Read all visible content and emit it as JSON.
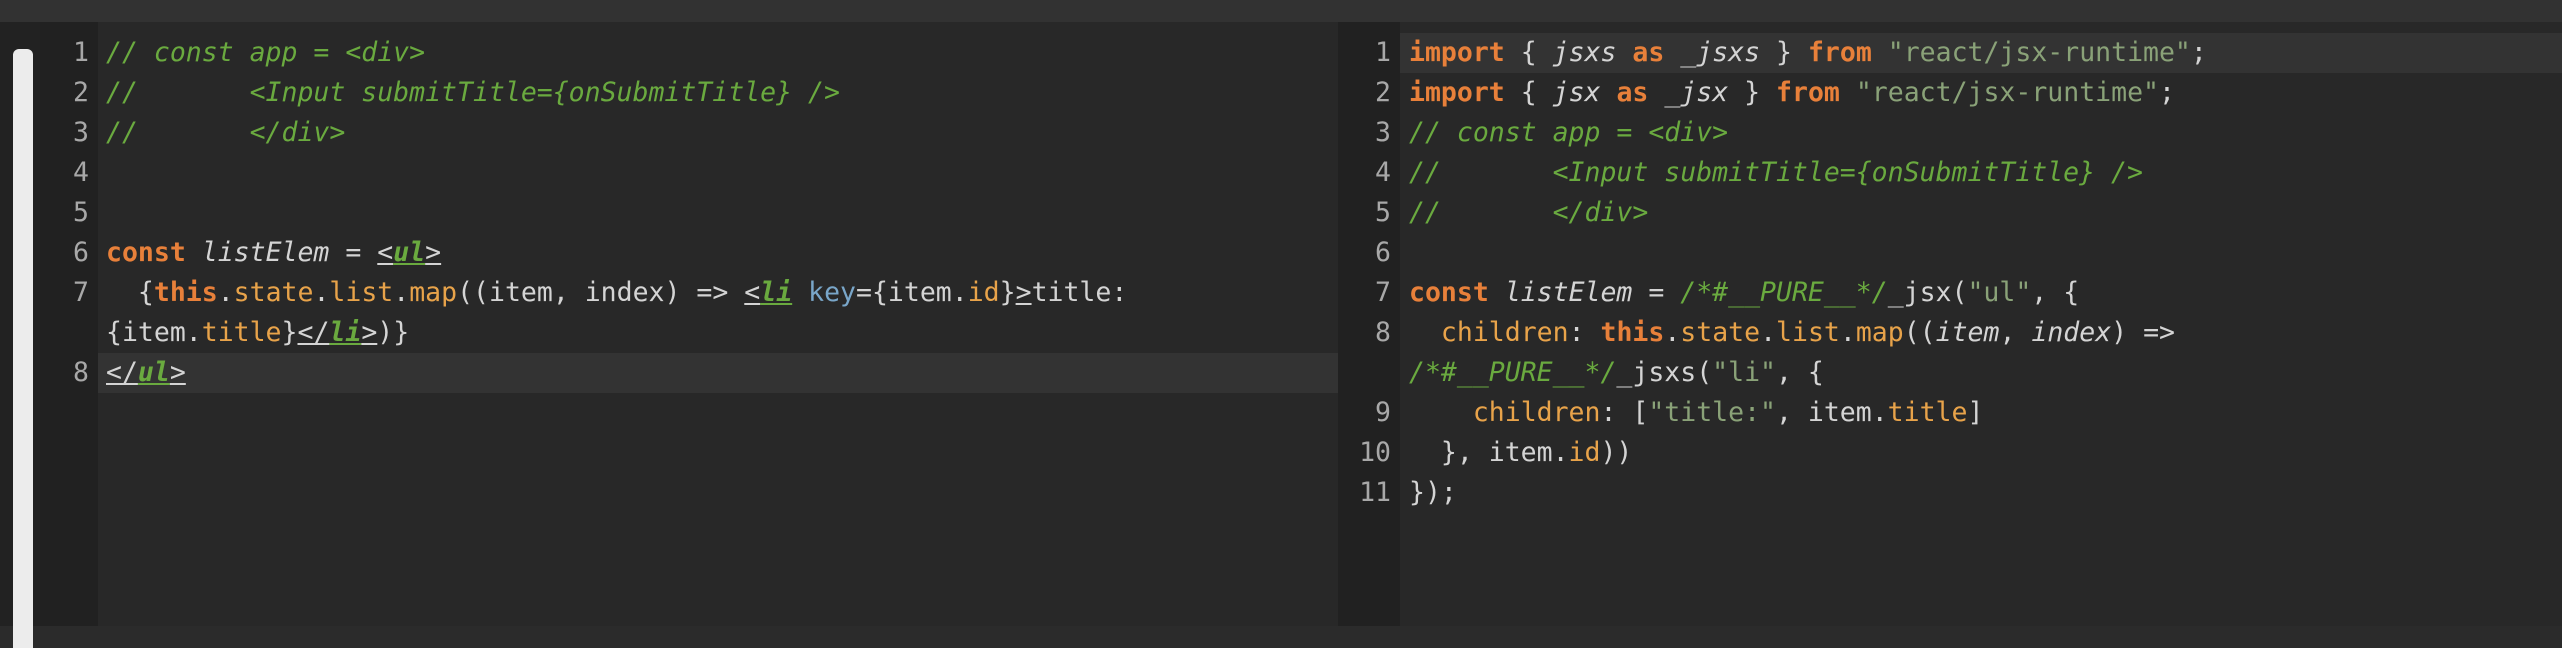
{
  "colors": {
    "background": "#2b2b2b",
    "editor_bg": "#282828",
    "gutter_bg": "#212121",
    "current_line": "#333333",
    "line_number": "#a8a8a8",
    "text": "#d4d4d4",
    "keyword": "#e8803a",
    "comment": "#6aaa3f",
    "property": "#e8a34a",
    "string": "#8aa278",
    "attribute": "#79a6c9",
    "scrollbar_thumb": "#ececec"
  },
  "left_editor": {
    "line_numbers": [
      "1",
      "2",
      "3",
      "4",
      "5",
      "6",
      "7",
      "",
      "8"
    ],
    "tokens": {
      "l1": "// const app = <div>",
      "l2": "//       <Input submitTitle={onSubmitTitle} />",
      "l3": "//       </div>",
      "l6_const": "const",
      "l6_name": "listElem",
      "l6_eq": " = ",
      "l6_lt": "<",
      "l6_tag": "ul",
      "l6_gt": ">",
      "l7_indent": "  {",
      "l7_this": "this",
      "l7_d1": ".",
      "l7_state": "state",
      "l7_d2": ".",
      "l7_list": "list",
      "l7_d3": ".",
      "l7_map": "map",
      "l7_args": "((item, index) => ",
      "l7_lt": "<",
      "l7_tag": "li",
      "l7_sp": " ",
      "l7_key": "key",
      "l7_eq": "={item.",
      "l7_id": "id",
      "l7_cb": "}",
      "l7_gt": ">",
      "l7_text": "title:",
      "l7b_open": "{item.",
      "l7b_title": "title",
      "l7b_close": "}",
      "l7b_lt": "</",
      "l7b_tag": "li",
      "l7b_gt": ">",
      "l7b_end": ")}",
      "l8_lt": "</",
      "l8_tag": "ul",
      "l8_gt": ">"
    }
  },
  "right_editor": {
    "line_numbers": [
      "1",
      "2",
      "3",
      "4",
      "5",
      "6",
      "7",
      "8",
      "",
      "9",
      "10",
      "11"
    ],
    "tokens": {
      "r1_import": "import",
      "r1_a": " { ",
      "r1_jsxs": "jsxs",
      "r1_sp1": " ",
      "r1_as": "as",
      "r1_sp2": " ",
      "r1_alias": "_jsxs",
      "r1_b": " } ",
      "r1_from": "from",
      "r1_sp3": " ",
      "r1_str": "\"react/jsx-runtime\"",
      "r1_semi": ";",
      "r2_import": "import",
      "r2_a": " { ",
      "r2_jsx": "jsx",
      "r2_sp1": " ",
      "r2_as": "as",
      "r2_sp2": " ",
      "r2_alias": "_jsx",
      "r2_b": " } ",
      "r2_from": "from",
      "r2_sp3": " ",
      "r2_str": "\"react/jsx-runtime\"",
      "r2_semi": ";",
      "r3": "// const app = <div>",
      "r4": "//       <Input submitTitle={onSubmitTitle} />",
      "r5": "//       </div>",
      "r7_const": "const",
      "r7_sp": " ",
      "r7_name": "listElem",
      "r7_eq": " = ",
      "r7_pure": "/*#__PURE__*/",
      "r7_fn": "_jsx(",
      "r7_str": "\"ul\"",
      "r7_rest": ", {",
      "r8_indent": "  ",
      "r8_children": "children",
      "r8_colon": ": ",
      "r8_this": "this",
      "r8_d1": ".",
      "r8_state": "state",
      "r8_d2": ".",
      "r8_list": "list",
      "r8_d3": ".",
      "r8_map": "map",
      "r8_p1": "((",
      "r8_item": "item",
      "r8_comma": ", ",
      "r8_index": "index",
      "r8_arrow": ") =>",
      "r8b_pure": "/*#__PURE__*/",
      "r8b_fn": "_jsxs(",
      "r8b_str": "\"li\"",
      "r8b_rest": ", {",
      "r9_indent": "    ",
      "r9_children": "children",
      "r9_colon": ": [",
      "r9_str": "\"title:\"",
      "r9_mid": ", item.",
      "r9_title": "title",
      "r9_end": "]",
      "r10_a": "  }, item.",
      "r10_id": "id",
      "r10_b": "))",
      "r11": "});"
    }
  }
}
